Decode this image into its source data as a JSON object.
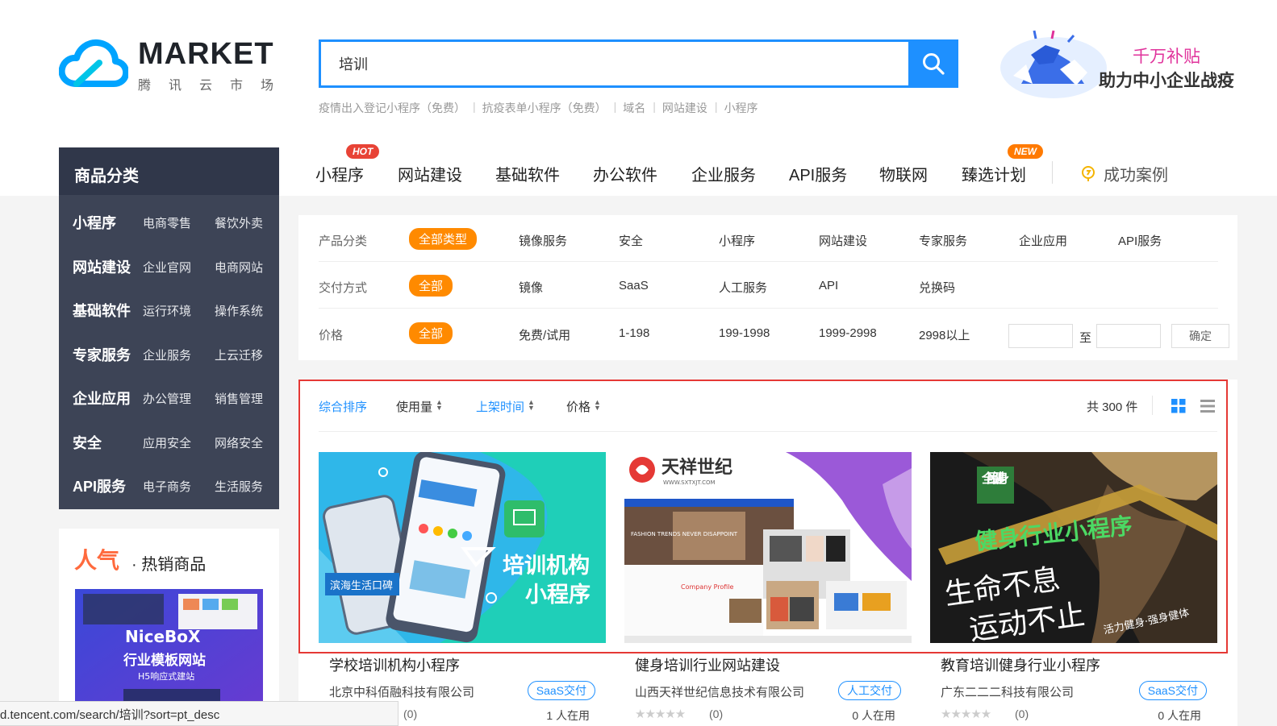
{
  "logo": {
    "title": "MARKET",
    "subtitle": "腾讯云市场"
  },
  "search": {
    "value": "培训",
    "placeholder": ""
  },
  "hot_words": [
    "疫情出入登记小程序（免费）",
    "抗疫表单小程序（免费）",
    "域名",
    "网站建设",
    "小程序"
  ],
  "promo": {
    "line1": "千万补贴",
    "line2": "助力中小企业战疫"
  },
  "categories": {
    "header": "商品分类",
    "rows": [
      {
        "main": "小程序",
        "sub1": "电商零售",
        "sub2": "餐饮外卖"
      },
      {
        "main": "网站建设",
        "sub1": "企业官网",
        "sub2": "电商网站"
      },
      {
        "main": "基础软件",
        "sub1": "运行环境",
        "sub2": "操作系统"
      },
      {
        "main": "专家服务",
        "sub1": "企业服务",
        "sub2": "上云迁移"
      },
      {
        "main": "企业应用",
        "sub1": "办公管理",
        "sub2": "销售管理"
      },
      {
        "main": "安全",
        "sub1": "应用安全",
        "sub2": "网络安全"
      },
      {
        "main": "API服务",
        "sub1": "电子商务",
        "sub2": "生活服务"
      }
    ]
  },
  "nav": {
    "items": [
      "小程序",
      "网站建设",
      "基础软件",
      "办公软件",
      "企业服务",
      "API服务",
      "物联网",
      "臻选计划"
    ],
    "hot_badge": "HOT",
    "new_badge": "NEW",
    "cases": "成功案例"
  },
  "filters": {
    "category": {
      "label": "产品分类",
      "options": [
        "全部类型",
        "镜像服务",
        "安全",
        "小程序",
        "网站建设",
        "专家服务",
        "企业应用",
        "API服务"
      ]
    },
    "delivery": {
      "label": "交付方式",
      "options": [
        "全部",
        "镜像",
        "SaaS",
        "人工服务",
        "API",
        "兑换码"
      ]
    },
    "price": {
      "label": "价格",
      "options": [
        "全部",
        "免费/试用",
        "1-198",
        "199-1998",
        "1999-2998",
        "2998以上"
      ],
      "to": "至",
      "confirm": "确定"
    }
  },
  "sort": {
    "items": [
      "综合排序",
      "使用量",
      "上架时间",
      "价格"
    ],
    "count": "共 300 件"
  },
  "products": [
    {
      "title": "学校培训机构小程序",
      "company": "北京中科佰融科技有限公司",
      "tag": "SaaS交付",
      "rating": "(0)",
      "usage": "1 人在用",
      "img_line1": "培训机构",
      "img_line2": "小程序",
      "img_badge": "滨海生活口碑"
    },
    {
      "title": "健身培训行业网站建设",
      "company": "山西天祥世纪信息技术有限公司",
      "tag": "人工交付",
      "rating": "(0)",
      "usage": "0 人在用",
      "img_brand": "天祥世纪",
      "img_url": "WWW.SXTXJT.COM",
      "img_caption": "FASHION TRENDS NEVER DISAPPOINT",
      "img_profile": "Company Profile"
    },
    {
      "title": "教育培训健身行业小程序",
      "company": "广东二二二科技有限公司",
      "tag": "SaaS交付",
      "rating": "(0)",
      "usage": "0 人在用",
      "img_badge": "全民健身",
      "img_line1": "健身行业小程序",
      "img_line2": "生命不息",
      "img_line3": "运动不止",
      "img_line4": "活力健身·强身健体"
    }
  ],
  "popular": {
    "title_a": "人气",
    "title_b": "· 热销商品",
    "img_brand": "NiceBoX",
    "img_line1": "行业模板网站",
    "img_line2": "H5响应式建站"
  },
  "status_url": "d.tencent.com/search/培训?sort=pt_desc",
  "colors": {
    "primary": "#1e90ff",
    "accent": "#ff8a00",
    "sidebar": "#3d4456",
    "frame": "#e53935"
  }
}
